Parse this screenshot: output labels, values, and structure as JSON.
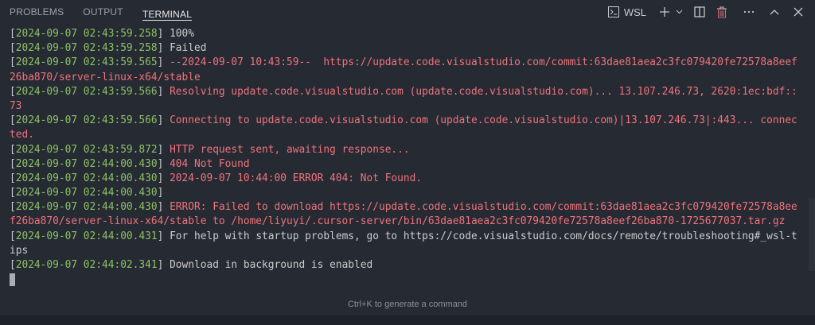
{
  "panel": {
    "tabs": [
      {
        "label": "PROBLEMS",
        "active": false
      },
      {
        "label": "OUTPUT",
        "active": false
      },
      {
        "label": "TERMINAL",
        "active": true
      }
    ],
    "actions": {
      "shell_label": "WSL",
      "icons": [
        "terminal-icon",
        "plus-icon",
        "chevron-down-icon",
        "split-icon",
        "trash-icon",
        "more-icon",
        "chevron-up-icon",
        "close-icon"
      ]
    }
  },
  "colors": {
    "background": "#262a33",
    "timestamp": "#8cc265",
    "error": "#f0737c",
    "text": "#cccccc"
  },
  "terminal": {
    "rows": [
      {
        "ts": "2024-09-07 02:43:59.258",
        "msg": "100%",
        "error": false
      },
      {
        "ts": "2024-09-07 02:43:59.258",
        "msg": "Failed",
        "error": false
      },
      {
        "ts": "2024-09-07 02:43:59.565",
        "msg": "--2024-09-07 10:43:59--  https://update.code.visualstudio.com/commit:63dae81aea2c3fc079420fe72578a8eef",
        "error": true
      },
      {
        "msg": "26ba870/server-linux-x64/stable",
        "error": true
      },
      {
        "ts": "2024-09-07 02:43:59.566",
        "msg": "Resolving update.code.visualstudio.com (update.code.visualstudio.com)... 13.107.246.73, 2620:1ec:bdf::",
        "error": true
      },
      {
        "msg": "73",
        "error": true
      },
      {
        "ts": "2024-09-07 02:43:59.566",
        "msg": "Connecting to update.code.visualstudio.com (update.code.visualstudio.com)|13.107.246.73|:443... connec",
        "error": true
      },
      {
        "msg": "ted.",
        "error": true
      },
      {
        "ts": "2024-09-07 02:43:59.872",
        "msg": "HTTP request sent, awaiting response...",
        "error": true
      },
      {
        "ts": "2024-09-07 02:44:00.430",
        "msg": "404 Not Found",
        "error": true
      },
      {
        "ts": "2024-09-07 02:44:00.430",
        "msg": "2024-09-07 10:44:00 ERROR 404: Not Found.",
        "error": true
      },
      {
        "ts": "2024-09-07 02:44:00.430",
        "msg": "",
        "error": true
      },
      {
        "ts": "2024-09-07 02:44:00.430",
        "msg": "ERROR: Failed to download https://update.code.visualstudio.com/commit:63dae81aea2c3fc079420fe72578a8ee",
        "error": true
      },
      {
        "msg": "f26ba870/server-linux-x64/stable to /home/liyuyi/.cursor-server/bin/63dae81aea2c3fc079420fe72578a8eef26ba870-1725677037.tar.gz",
        "error": true
      },
      {
        "ts": "2024-09-07 02:44:00.431",
        "msg": "For help with startup problems, go to https://code.visualstudio.com/docs/remote/troubleshooting#_wsl-t",
        "error": false
      },
      {
        "msg": "ips",
        "error": false
      },
      {
        "ts": "2024-09-07 02:44:02.341",
        "msg": "Download in background is enabled",
        "error": false
      }
    ]
  },
  "hint": "Ctrl+K to generate a command"
}
